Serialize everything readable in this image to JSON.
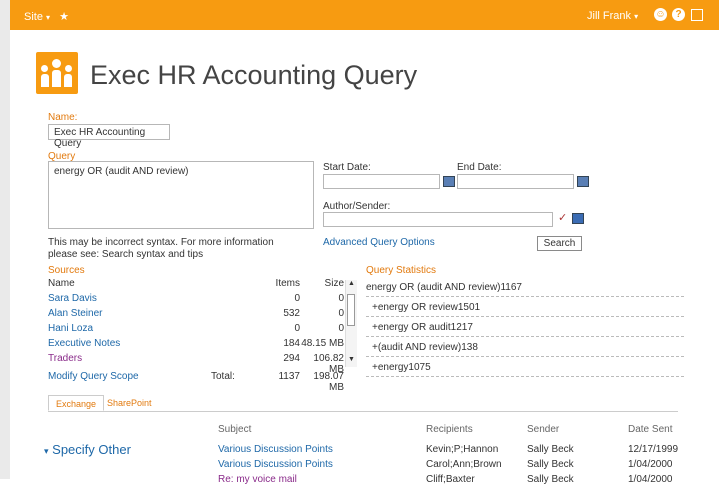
{
  "topbar": {
    "site": "Site",
    "site_caret": "▾",
    "star": "★",
    "user": "Jill Frank",
    "user_caret": "▾",
    "smile": "☺",
    "help": "?"
  },
  "page": {
    "title": "Exec HR Accounting Query"
  },
  "form": {
    "name_label": "Name:",
    "name_value": "Exec HR Accounting Query",
    "query_label": "Query",
    "query_value": "energy OR (audit AND review)",
    "start_label": "Start Date:",
    "end_label": "End Date:",
    "author_label": "Author/Sender:",
    "advanced_link": "Advanced Query Options",
    "search_button": "Search",
    "syntax_note_1": "This may be incorrect syntax. For more information",
    "syntax_note_2": "please see: Search syntax and tips"
  },
  "sources": {
    "label": "Sources",
    "headers": {
      "name": "Name",
      "items": "Items",
      "size": "Size"
    },
    "rows": [
      {
        "name": "Sara Davis",
        "items": "0",
        "size": "0"
      },
      {
        "name": "Alan Steiner",
        "items": "532",
        "size": "0"
      },
      {
        "name": "Hani Loza",
        "items": "0",
        "size": "0"
      },
      {
        "name": "Executive Notes",
        "items": "184",
        "size": "48.15 MB"
      },
      {
        "name": "Traders",
        "items": "294",
        "size": "106.82 MB"
      }
    ],
    "modify_link": "Modify Query Scope",
    "total_label": "Total:",
    "total_items": "1137",
    "total_size": "198.07 MB"
  },
  "stats": {
    "label": "Query Statistics",
    "header": "energy OR (audit AND review)1167",
    "rows": [
      "+energy OR review1501",
      "+energy OR audit1217",
      "+(audit AND review)138",
      "+energy1075"
    ]
  },
  "tabs": [
    "Exchange",
    "SharePoint"
  ],
  "results": {
    "headers": {
      "subject": "Subject",
      "recipients": "Recipients",
      "sender": "Sender",
      "date": "Date Sent"
    },
    "specify_other": "Specify Other",
    "rows": [
      {
        "subject": "Various Discussion Points",
        "recipients": "Kevin;P;Hannon",
        "sender": "Sally Beck",
        "date": "12/17/1999"
      },
      {
        "subject": "Various Discussion Points",
        "recipients": "Carol;Ann;Brown",
        "sender": "Sally Beck",
        "date": "1/04/2000"
      },
      {
        "subject": "Re: my voice mail",
        "recipients": "Cliff;Baxter",
        "sender": "Sally Beck",
        "date": "1/04/2000"
      }
    ]
  }
}
